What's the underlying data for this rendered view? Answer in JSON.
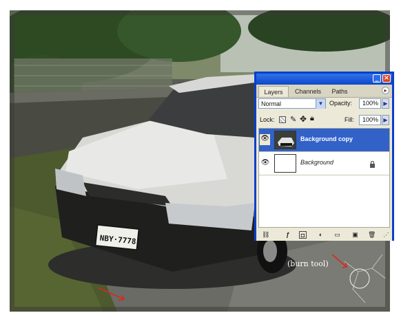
{
  "scene": {
    "annotation_text": "(burn tool)"
  },
  "layers_panel": {
    "tabs": [
      "Layers",
      "Channels",
      "Paths"
    ],
    "blend_mode": "Normal",
    "opacity_label": "Opacity:",
    "opacity_value": "100%",
    "lock_label": "Lock:",
    "fill_label": "Fill:",
    "fill_value": "100%",
    "layers": [
      {
        "name": "Background copy",
        "selected": true
      },
      {
        "name": "Background",
        "selected": false,
        "locked": true
      }
    ]
  },
  "colors": {
    "panel_border": "#0a3fc9",
    "selection": "#3262c8",
    "arrow_red": "#d8281c"
  }
}
